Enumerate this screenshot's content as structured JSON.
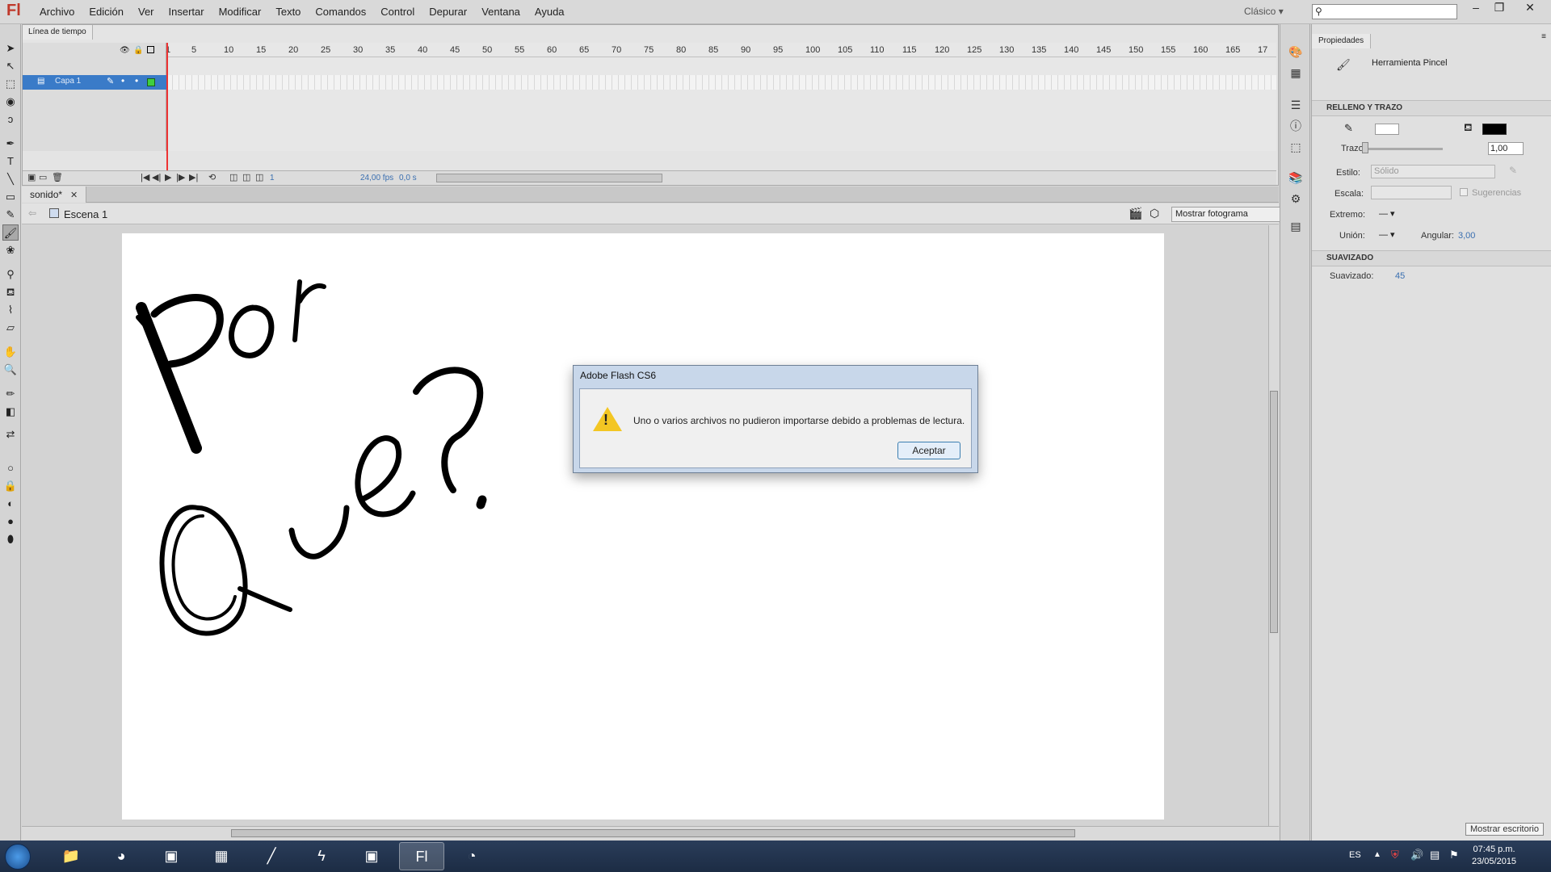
{
  "app": {
    "logo": "Fl",
    "menu": [
      "Archivo",
      "Edición",
      "Ver",
      "Insertar",
      "Modificar",
      "Texto",
      "Comandos",
      "Control",
      "Depurar",
      "Ventana",
      "Ayuda"
    ],
    "workspace": "Clásico",
    "search_placeholder": ""
  },
  "timeline": {
    "tab_label": "Línea de tiempo",
    "layer_name": "Capa 1",
    "ruler_ticks": [
      "1",
      "5",
      "10",
      "15",
      "20",
      "25",
      "30",
      "35",
      "40",
      "45",
      "50",
      "55",
      "60",
      "65",
      "70",
      "75",
      "80",
      "85",
      "90",
      "95",
      "100",
      "105",
      "110",
      "115",
      "120",
      "125",
      "130",
      "135",
      "140",
      "145",
      "150",
      "155",
      "160",
      "165",
      "17"
    ],
    "current_frame": "1",
    "fps": "24,00 fps",
    "time": "0,0 s"
  },
  "document": {
    "tab_label": "sonido*",
    "scene": "Escena 1",
    "view_mode": "Mostrar fotograma"
  },
  "dialog": {
    "title": "Adobe Flash CS6",
    "message": "Uno o varios archivos no pudieron importarse debido a problemas de lectura.",
    "ok_label": "Aceptar"
  },
  "properties": {
    "tab_label": "Propiedades",
    "tool_name": "Herramienta Pincel",
    "section_fill_stroke": "RELLENO Y TRAZO",
    "stroke_label": "Trazo:",
    "stroke_value": "1,00",
    "style_label": "Estilo:",
    "style_value": "Sólido",
    "scale_label": "Escala:",
    "hints_label": "Sugerencias",
    "cap_label": "Extremo:",
    "join_label": "Unión:",
    "miter_label": "Angular:",
    "miter_value": "3,00",
    "section_smoothing": "SUAVIZADO",
    "smoothing_label": "Suavizado:",
    "smoothing_value": "45"
  },
  "taskbar": {
    "lang": "ES",
    "time": "07:45 p.m.",
    "date": "23/05/2015",
    "show_desktop": "Mostrar escritorio"
  },
  "colors": {
    "fill": "#000000",
    "layer_highlight": "#3a7bc8",
    "playhead": "#ee3333"
  }
}
